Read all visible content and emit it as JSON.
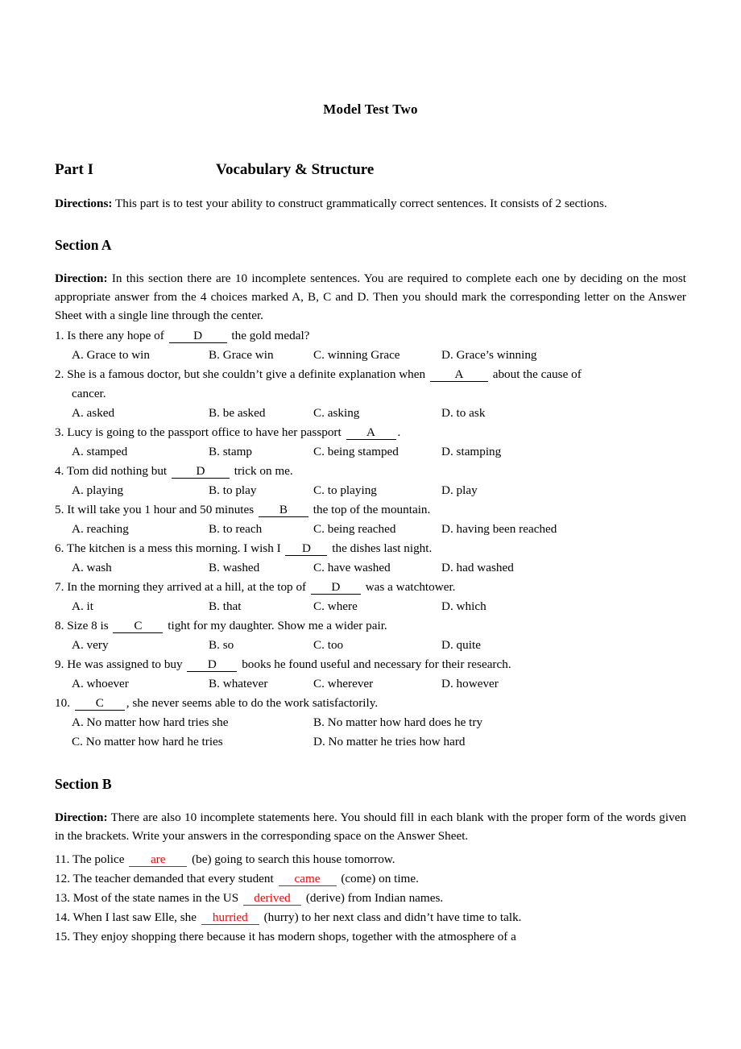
{
  "document": {
    "title": "Model Test Two"
  },
  "part": {
    "label": "Part I",
    "title": "Vocabulary & Structure",
    "directions_lead": "Directions:",
    "directions_text": " This part is to test your ability to construct grammatically correct sentences. It consists of 2 sections."
  },
  "section_a": {
    "heading": "Section A",
    "direction_lead": "Direction:",
    "direction_text": " In this section there are 10 incomplete sentences. You are required to complete each one by deciding on the most appropriate answer from the 4 choices marked A, B, C and D. Then you should mark the corresponding letter on the Answer Sheet with a single line through the center.",
    "questions": [
      {
        "number": "1.",
        "stem_before": " Is there any hope of ",
        "answer": "D",
        "stem_after": " the gold medal?",
        "continuation": "",
        "options": [
          "A. Grace to win",
          "B. Grace win",
          "C. winning Grace",
          "D. Grace’s winning"
        ]
      },
      {
        "number": "2.",
        "stem_before": " She is a famous doctor, but she couldn’t give a definite explanation when ",
        "answer": "A",
        "stem_after": " about the cause of",
        "continuation": "cancer.",
        "options": [
          "A. asked",
          "B. be asked",
          "C. asking",
          "D. to ask"
        ]
      },
      {
        "number": "3.",
        "stem_before": " Lucy is going to the passport office to have her passport ",
        "answer": "A",
        "stem_after": ".",
        "continuation": "",
        "options": [
          "A. stamped",
          "B. stamp",
          "C. being stamped",
          "D. stamping"
        ]
      },
      {
        "number": "4.",
        "stem_before": " Tom did nothing but ",
        "answer": "D",
        "stem_after": " trick on me.",
        "continuation": "",
        "options": [
          "A. playing",
          "B. to play",
          "C. to playing",
          "D. play"
        ]
      },
      {
        "number": "5.",
        "stem_before": " It will take you 1 hour and 50 minutes ",
        "answer": "B",
        "stem_after": " the top of the mountain.",
        "continuation": "",
        "options": [
          "A. reaching",
          "B. to reach",
          "C. being reached",
          "D. having been reached"
        ]
      },
      {
        "number": "6.",
        "stem_before": " The kitchen is a mess this morning. I wish I ",
        "answer": "D",
        "stem_after": " the dishes last night.",
        "continuation": "",
        "options": [
          "A. wash",
          "B. washed",
          "C. have washed",
          "D. had washed"
        ]
      },
      {
        "number": "7.",
        "stem_before": " In the morning they arrived at a hill, at the top of ",
        "answer": "D",
        "stem_after": " was a watchtower.",
        "continuation": "",
        "options": [
          "A. it",
          "B. that",
          "C. where",
          "D. which"
        ]
      },
      {
        "number": "8.",
        "stem_before": " Size 8 is ",
        "answer": "C",
        "stem_after": " tight for my daughter. Show me a wider pair.",
        "continuation": "",
        "options": [
          "A. very",
          "B. so",
          "C. too",
          "D. quite"
        ]
      },
      {
        "number": "9.",
        "stem_before": " He was assigned to buy ",
        "answer": "D",
        "stem_after": " books he found useful and necessary for their research.",
        "continuation": "",
        "options": [
          "A. whoever",
          "B. whatever",
          "C. wherever",
          "D. however"
        ]
      }
    ],
    "question10": {
      "number": "10.",
      "stem_before": " ",
      "answer": "C",
      "stem_after": ", she never seems able to do the work satisfactorily.",
      "options_row1": [
        "A. No matter how hard tries she",
        "B. No matter how hard does he try"
      ],
      "options_row2": [
        "C. No matter how hard he tries",
        "D. No matter he tries how hard"
      ]
    }
  },
  "section_b": {
    "heading": "Section B",
    "direction_lead": "Direction:",
    "direction_text": " There are also 10 incomplete statements here. You should fill in each blank with the proper form of the words given in the brackets. Write your answers in the corresponding space on the Answer Sheet.",
    "items": [
      {
        "number": "11.",
        "before": " The police ",
        "answer": "are",
        "after": " (be) going to search this house tomorrow."
      },
      {
        "number": "12.",
        "before": " The teacher demanded that every student ",
        "answer": "came",
        "after": " (come) on time."
      },
      {
        "number": "13.",
        "before": " Most of the state names in the US ",
        "answer": "derived",
        "after": " (derive) from Indian names."
      },
      {
        "number": "14.",
        "before": " When I last saw Elle, she ",
        "answer": "hurried",
        "after": " (hurry) to her next class and didn’t have time to talk."
      },
      {
        "number": "15.",
        "before": " They enjoy shopping there because it has modern shops, together with the atmosphere of a",
        "answer": "",
        "after": ""
      }
    ]
  },
  "colors": {
    "answer_red": "#ff0000",
    "text_black": "#000000"
  }
}
